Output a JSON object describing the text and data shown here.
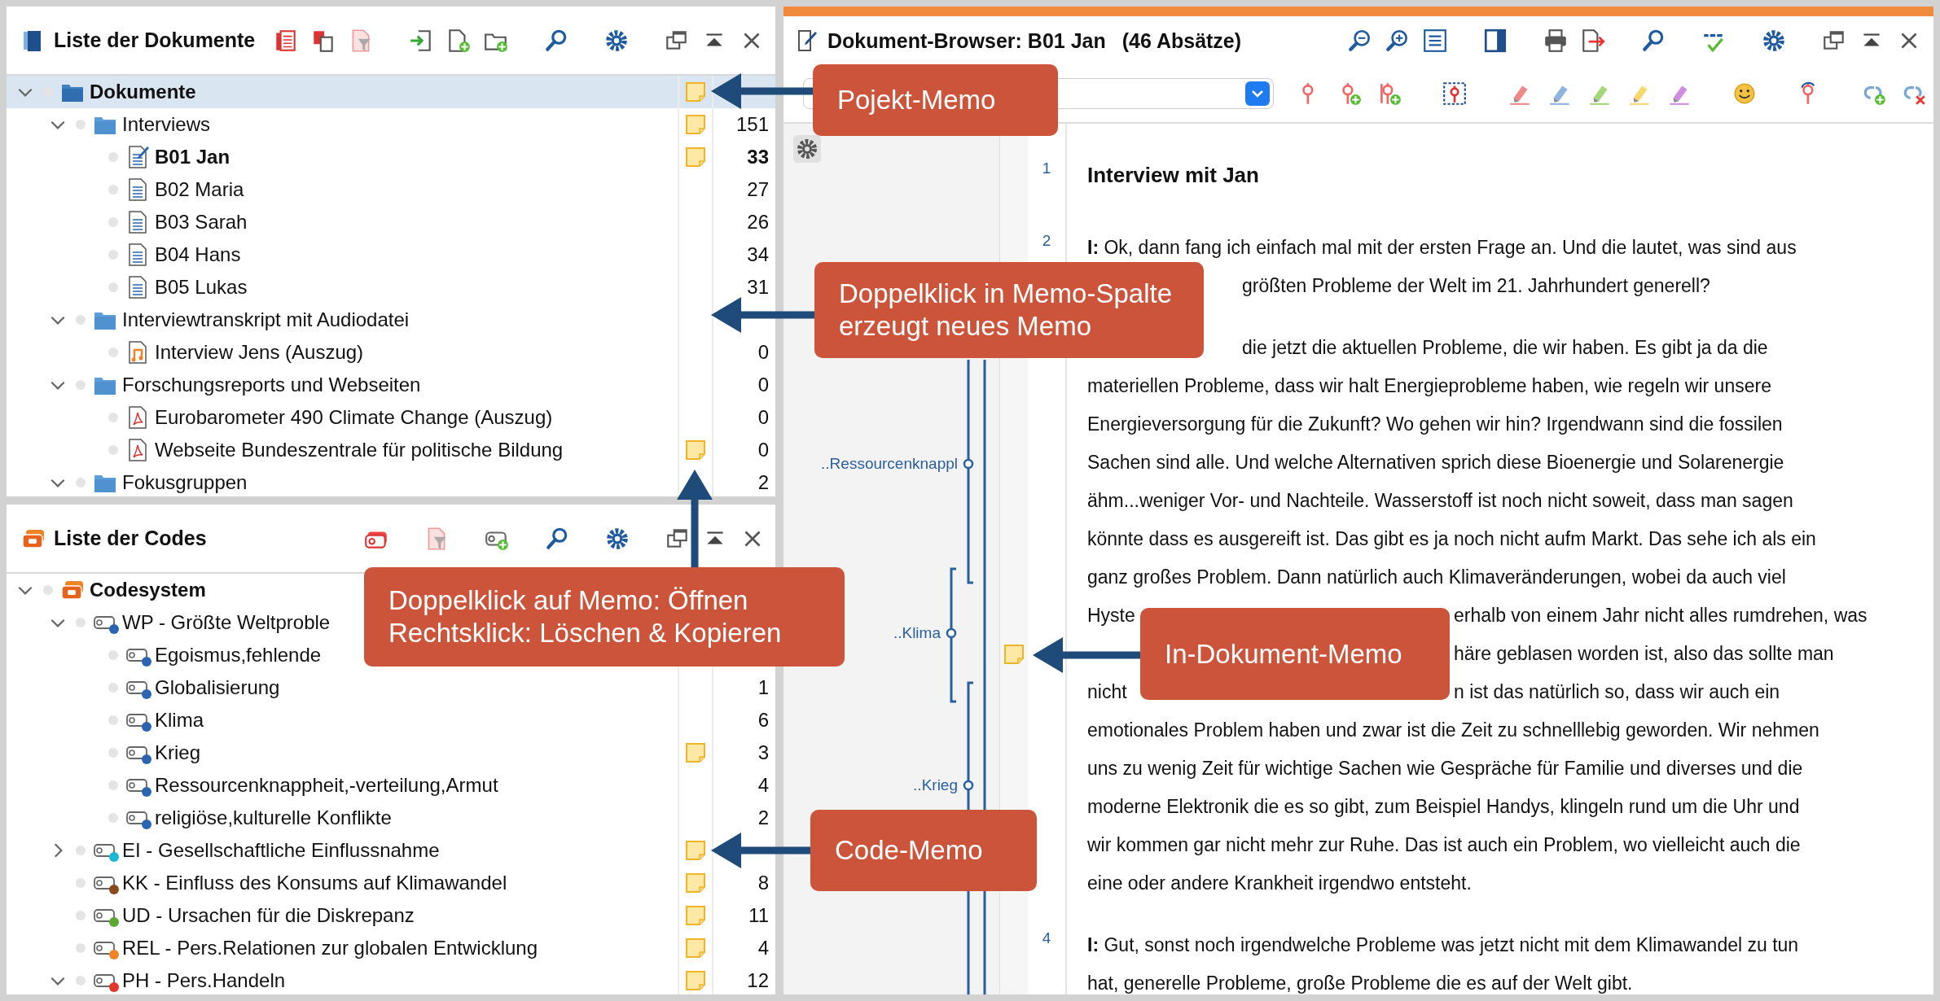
{
  "documents_panel": {
    "title": "Liste der Dokumente",
    "tree": [
      {
        "kind": "root",
        "label": "Dokumente",
        "selected": true,
        "expanded": true,
        "memo": true,
        "children": [
          {
            "kind": "folder",
            "label": "Interviews",
            "selected": false,
            "expanded": true,
            "memo": true,
            "count": "151",
            "children": [
              {
                "kind": "text_open",
                "label": "B01 Jan",
                "selected": false,
                "memo": true,
                "count": "33"
              },
              {
                "kind": "text",
                "label": "B02 Maria",
                "selected": false,
                "memo": false,
                "count": "27"
              },
              {
                "kind": "text",
                "label": "B03 Sarah",
                "selected": false,
                "memo": false,
                "count": "26"
              },
              {
                "kind": "text",
                "label": "B04 Hans",
                "selected": false,
                "memo": false,
                "count": "34"
              },
              {
                "kind": "text",
                "label": "B05 Lukas",
                "selected": false,
                "memo": false,
                "count": "31"
              }
            ]
          },
          {
            "kind": "folder",
            "label": "Interviewtranskript mit Audiodatei",
            "selected": false,
            "expanded": true,
            "memo": false,
            "children": [
              {
                "kind": "audio",
                "label": "Interview Jens (Auszug)",
                "selected": false,
                "memo": false,
                "count": "0"
              }
            ]
          },
          {
            "kind": "folder",
            "label": "Forschungsreports und Webseiten",
            "selected": false,
            "expanded": true,
            "memo": false,
            "count": "0",
            "children": [
              {
                "kind": "pdf",
                "label": "Eurobarometer 490 Climate Change (Auszug)",
                "selected": false,
                "memo": false,
                "count": "0"
              },
              {
                "kind": "pdf",
                "label": "Webseite Bundeszentrale für politische Bildung",
                "selected": false,
                "memo": true,
                "count": "0"
              }
            ]
          },
          {
            "kind": "folder",
            "label": "Fokusgruppen",
            "selected": false,
            "expanded": true,
            "memo": false,
            "count": "2"
          }
        ]
      }
    ]
  },
  "codes_panel": {
    "title": "Liste der Codes",
    "tree": [
      {
        "kind": "code_root",
        "label": "Codesystem",
        "selected": false,
        "expanded": true,
        "memo": false,
        "children": [
          {
            "kind": "code",
            "label": "WP - Größte Weltproble",
            "color": "#2a64b0",
            "selected": false,
            "expanded": true,
            "memo": false,
            "children": [
              {
                "kind": "code",
                "label": "Egoismus,fehlende",
                "color": "#2a64b0",
                "selected": false,
                "memo": false
              },
              {
                "kind": "code",
                "label": "Globalisierung",
                "color": "#2a64b0",
                "selected": false,
                "memo": false,
                "count": "1"
              },
              {
                "kind": "code",
                "label": "Klima",
                "color": "#2a64b0",
                "selected": false,
                "memo": false,
                "count": "6"
              },
              {
                "kind": "code",
                "label": "Krieg",
                "color": "#2a64b0",
                "selected": false,
                "memo": true,
                "count": "3"
              },
              {
                "kind": "code",
                "label": "Ressourcenknappheit,-verteilung,Armut",
                "color": "#2a64b0",
                "selected": false,
                "memo": false,
                "count": "4"
              },
              {
                "kind": "code",
                "label": "religiöse,kulturelle Konflikte",
                "color": "#2a64b0",
                "selected": false,
                "memo": false,
                "count": "2"
              }
            ]
          },
          {
            "kind": "code",
            "label": "EI - Gesellschaftliche Einflussnahme",
            "color": "#1bb8d6",
            "selected": false,
            "expanded": false,
            "memo": true
          },
          {
            "kind": "code",
            "label": "KK - Einfluss des Konsums auf Klimawandel",
            "color": "#8a4a1c",
            "selected": false,
            "memo": true,
            "count": "8"
          },
          {
            "kind": "code",
            "label": "UD - Ursachen für die Diskrepanz",
            "color": "#5aa832",
            "selected": false,
            "memo": true,
            "count": "11"
          },
          {
            "kind": "code",
            "label": "REL - Pers.Relationen zur globalen Entwicklung",
            "color": "#f08424",
            "selected": false,
            "memo": true,
            "count": "4"
          },
          {
            "kind": "code",
            "label": "PH - Pers.Handeln",
            "color": "#e2362a",
            "selected": false,
            "expanded": true,
            "memo": true,
            "count": "12"
          }
        ]
      }
    ]
  },
  "document_browser": {
    "title": "Dokument-Browser: B01 Jan",
    "info": "(46 Absätze)",
    "code_stripes": [
      {
        "label": "..Ressourcenknappl"
      },
      {
        "label": "..Klima"
      },
      {
        "label": "..Krieg"
      }
    ],
    "paragraphs": [
      {
        "number": "1",
        "lines": [
          {
            "kind": "heading",
            "text": "Interview mit Jan"
          }
        ]
      },
      {
        "number": "2",
        "lines": [
          {
            "kind": "full",
            "text": "**I:** Ok, dann fang ich einfach mal mit der ersten Frage an. Und die lautet, was sind aus"
          },
          {
            "kind": "narrow_gap",
            "tail": "größten Probleme der Welt im 21. Jahrhundert generell?"
          }
        ]
      },
      {
        "lines": [
          {
            "kind": "narrow_gap",
            "tail": "die jetzt die aktuellen Probleme, die wir haben. Es gibt ja da die"
          },
          {
            "kind": "full",
            "text": "materiellen Probleme, dass wir halt Energieprobleme haben, wie regeln wir unsere"
          },
          {
            "kind": "full",
            "text": "Energieversorgung für die Zukunft? Wo gehen wir hin? Irgendwann sind die fossilen"
          },
          {
            "kind": "full",
            "text": "Sachen sind alle. Und welche Alternativen sprich diese Bioenergie und Solarenergie"
          },
          {
            "kind": "full",
            "text": "ähm...weniger Vor- und Nachteile. Wasserstoff ist noch nicht soweit, dass man sagen"
          },
          {
            "kind": "full",
            "text": "könnte dass es ausgereift ist. Das gibt es ja noch nicht aufm Markt. Das sehe ich als ein"
          },
          {
            "kind": "full",
            "text": "ganz großes Problem. Dann natürlich auch Klimaveränderungen, wobei da auch viel"
          },
          {
            "kind": "wide_gap",
            "lead": "Hyste",
            "tail": "erhalb von einem Jahr nicht alles rumdrehen, was"
          },
          {
            "kind": "wide_gap",
            "memo": true,
            "tail": "häre geblasen worden ist, also das sollte man"
          },
          {
            "kind": "wide_gap",
            "lead": "nicht",
            "tail": "n ist das natürlich so, dass wir auch ein"
          },
          {
            "kind": "full",
            "text": "emotionales Problem haben und zwar ist die Zeit zu schnelllebig geworden. Wir nehmen"
          },
          {
            "kind": "full",
            "text": "uns zu wenig Zeit für wichtige Sachen wie Gespräche für Familie und diverses und die"
          },
          {
            "kind": "full",
            "text": "moderne Elektronik die es so gibt, zum Beispiel Handys, klingeln rund um die Uhr und"
          },
          {
            "kind": "full",
            "text": "wir kommen gar nicht mehr zur Ruhe. Das ist auch ein Problem, wo vielleicht auch die"
          },
          {
            "kind": "full",
            "text": "eine oder andere Krankheit irgendwo entsteht."
          }
        ]
      },
      {
        "number": "4",
        "lines": [
          {
            "kind": "full",
            "text": "**I:** Gut, sonst noch irgendwelche Probleme was jetzt nicht mit dem Klimawandel zu tun"
          },
          {
            "kind": "full",
            "text": "hat, generelle Probleme, große Probleme die es auf der Welt gibt."
          }
        ]
      }
    ]
  },
  "callouts": [
    {
      "text": "Pojekt-Memo"
    },
    {
      "text": "Doppelklick in Memo-Spalte\nerzeugt neues Memo"
    },
    {
      "text": "Doppelklick auf Memo: Öffnen\nRechtsklick: Löschen & Kopieren"
    },
    {
      "text": "Code-Memo"
    },
    {
      "text": "In-Dokument-Memo"
    }
  ]
}
